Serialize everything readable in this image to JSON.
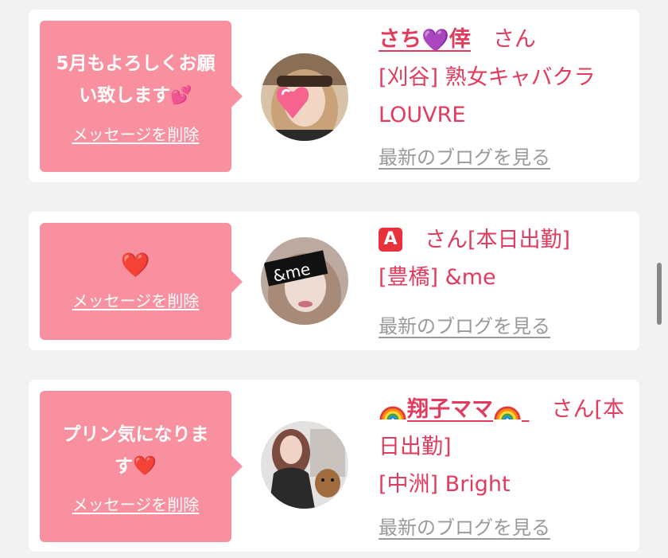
{
  "cards": [
    {
      "message": "5月もよろしくお願い致します",
      "message_emoji": "💕",
      "delete_label": "メッセージを削除",
      "name": "さち",
      "name_emoji": "💜",
      "name_suffix": "倖",
      "san": "さん",
      "area": "[刈谷]",
      "shop": "熟女キャバクラ",
      "shop2": "LOUVRE",
      "blog_label": "最新のブログを見る"
    },
    {
      "message": "❤️",
      "delete_label": "メッセージを削除",
      "name_badge": "A",
      "san": "さん[本日出勤]",
      "area": "[豊橋]",
      "shop": "&me",
      "blog_label": "最新のブログを見る",
      "avatar_text": "&me"
    },
    {
      "message": "プリン気になりま",
      "message2": "す",
      "message_emoji": "❤️",
      "delete_label": "メッセージを削除",
      "name": "翔子ママ",
      "san": "さん[本",
      "san2": "日出勤]",
      "area": "[中洲]",
      "shop": "Bright",
      "blog_label": "最新のブログを見る"
    }
  ],
  "icons": [
    "heart-icon",
    "purple-heart-icon",
    "a-badge-icon",
    "rainbow-icon"
  ],
  "colors": {
    "bubble": "#f9909f",
    "accent_text": "#e23b5d",
    "blog_link": "#9a9a9a",
    "background": "#f2f2f2"
  }
}
